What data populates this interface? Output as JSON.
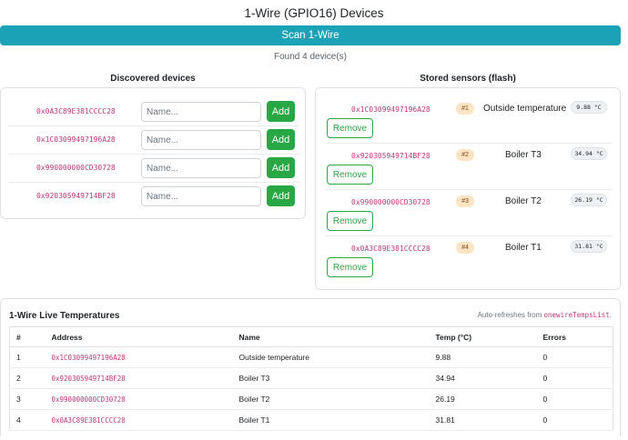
{
  "header": {
    "title": "1-Wire (GPIO16) Devices",
    "scan_label": "Scan 1-Wire",
    "found_text": "Found 4 device(s)"
  },
  "discovered": {
    "title": "Discovered devices",
    "name_placeholder": "Name...",
    "add_label": "Add",
    "items": [
      {
        "address": "0x0A3C89E381CCCC28"
      },
      {
        "address": "0x1C03099497196A28"
      },
      {
        "address": "0x990000000CD30728"
      },
      {
        "address": "0x920305949714BF28"
      }
    ]
  },
  "stored": {
    "title": "Stored sensors (flash)",
    "remove_label": "Remove",
    "items": [
      {
        "address": "0x1C03099497196A28",
        "slot": "#1",
        "name": "Outside temperature",
        "temp": "9.88 °C"
      },
      {
        "address": "0x920305949714BF28",
        "slot": "#2",
        "name": "Boiler T3",
        "temp": "34.94 °C"
      },
      {
        "address": "0x990000000CD30728",
        "slot": "#3",
        "name": "Boiler T2",
        "temp": "26.19 °C"
      },
      {
        "address": "0x0A3C89E381CCCC28",
        "slot": "#4",
        "name": "Boiler T1",
        "temp": "31.81 °C"
      }
    ]
  },
  "live": {
    "title": "1-Wire Live Temperatures",
    "refresh_prefix": "Auto-refreshes from",
    "refresh_source": "onewireTempsList",
    "refresh_suffix": ".",
    "columns": [
      "#",
      "Address",
      "Name",
      "Temp (°C)",
      "Errors"
    ],
    "rows": [
      {
        "num": "1",
        "address": "0x1C03099497196A28",
        "name": "Outside temperature",
        "temp": "9.88",
        "errors": "0"
      },
      {
        "num": "2",
        "address": "0x920305949714BF28",
        "name": "Boiler T3",
        "temp": "34.94",
        "errors": "0"
      },
      {
        "num": "3",
        "address": "0x990000000CD30728",
        "name": "Boiler T2",
        "temp": "26.19",
        "errors": "0"
      },
      {
        "num": "4",
        "address": "0x0A3C89E381CCCC28",
        "name": "Boiler T1",
        "temp": "31.81",
        "errors": "0"
      }
    ]
  },
  "colors": {
    "scan_button": "#1ba2b7",
    "add_button": "#28a745",
    "remove_outline": "#28a745",
    "address_text": "#c0377a",
    "slot_badge": "#fde4c4"
  }
}
